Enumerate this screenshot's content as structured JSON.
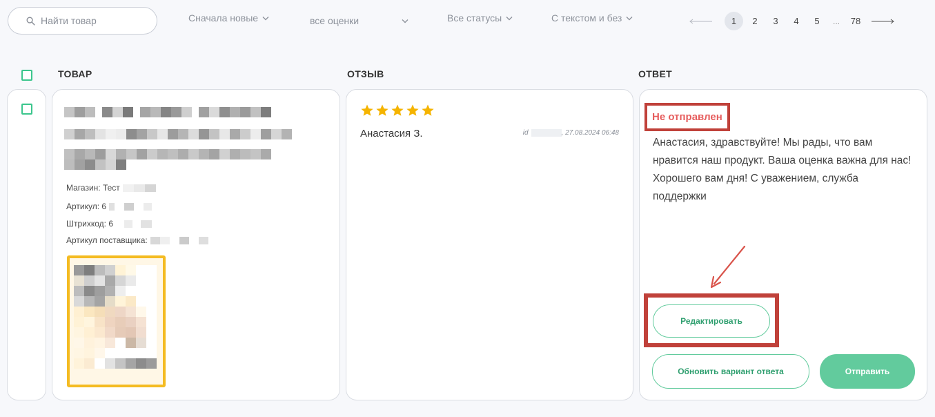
{
  "toolbar": {
    "search_placeholder": "Найти товар",
    "sort_label": "Сначала новые",
    "rating_label": "все оценки",
    "status_label": "Все статусы",
    "text_label": "С текстом и без"
  },
  "pagination": {
    "pages": [
      "1",
      "2",
      "3",
      "4",
      "5"
    ],
    "ellipsis": "...",
    "last": "78",
    "current": "1"
  },
  "columns": {
    "product": "ТОВАР",
    "review": "ОТЗЫВ",
    "answer": "ОТВЕТ"
  },
  "product": {
    "store_label": "Магазин: Тест",
    "article_label": "Артикул: 6",
    "barcode_label": "Штрихкод: 6",
    "supplier_article_label": "Артикул поставщика:"
  },
  "review": {
    "rating": 5,
    "author": "Анастасия З.",
    "id_prefix": "id",
    "date": ", 27.08.2024 06:48"
  },
  "answer": {
    "status": "Не отправлен",
    "text": "Анастасия, здравствуйте! Мы рады, что вам нравится наш продукт. Ваша оценка важна для нас! Хорошего вам дня! С уважением, служба поддержки",
    "edit_label": "Редактировать",
    "update_label": "Обновить вариант ответа",
    "send_label": "Отправить"
  },
  "colors": {
    "accent_green": "#62cb9d",
    "star": "#f5b400",
    "status_red": "#e65d5d",
    "annotation_red": "#c0413a"
  }
}
